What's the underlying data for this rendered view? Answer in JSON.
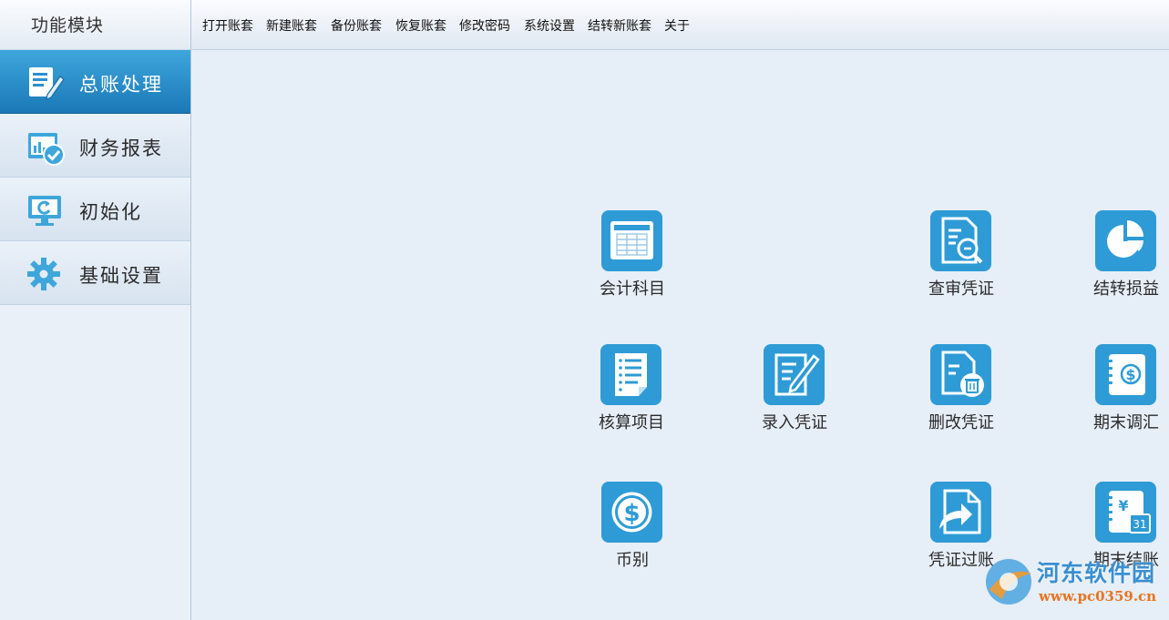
{
  "sidebar": {
    "title": "功能模块",
    "items": [
      {
        "label": "总账处理",
        "active": true
      },
      {
        "label": "财务报表",
        "active": false
      },
      {
        "label": "初始化",
        "active": false
      },
      {
        "label": "基础设置",
        "active": false
      }
    ]
  },
  "menu": {
    "items": [
      "打开账套",
      "新建账套",
      "备份账套",
      "恢复账套",
      "修改密码",
      "系统设置",
      "结转新账套",
      "关于"
    ]
  },
  "tiles": {
    "accounting_subjects": "会计科目",
    "review_voucher": "查审凭证",
    "carry_forward_pl": "结转损益",
    "accounting_items": "核算项目",
    "enter_voucher": "录入凭证",
    "delete_voucher": "删改凭证",
    "period_end_adjust": "期末调汇",
    "currency": "币别",
    "post_voucher": "凭证过账",
    "period_end_close": "期末结账"
  },
  "watermark": {
    "name": "河东软件园",
    "url": "www.pc0359.cn"
  },
  "colors": {
    "accent": "#2e9bd6",
    "active_nav": "#1b78b8",
    "background": "#e6eef7"
  }
}
